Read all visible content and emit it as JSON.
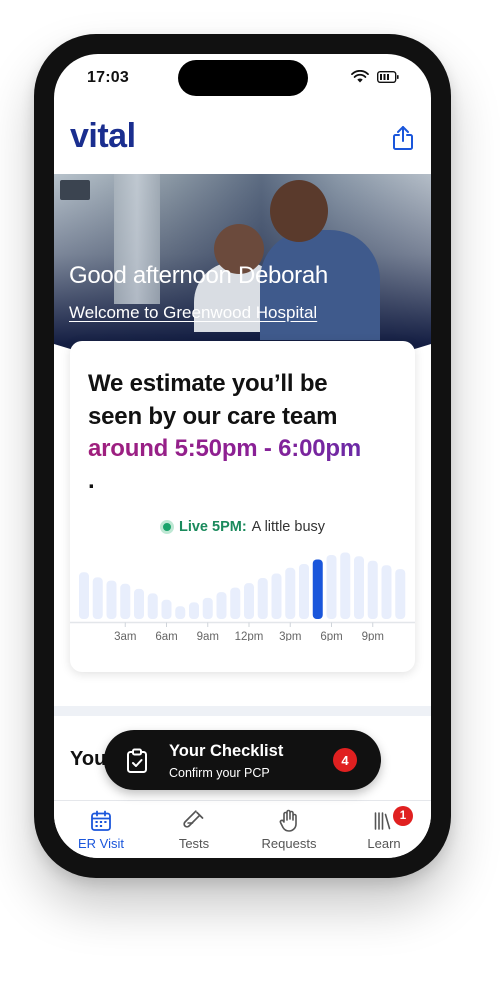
{
  "status_bar": {
    "time": "17:03"
  },
  "header": {
    "logo": "vital",
    "share_icon": "share-icon"
  },
  "hero": {
    "greeting": "Good afternoon Deborah",
    "welcome_link": "Welcome to Greenwood Hospital"
  },
  "estimate": {
    "line1": "We estimate you’ll be",
    "line2": "seen by our care team",
    "range": "around 5:50pm - 6:00pm",
    "trailing": ".",
    "live_label": "Live 5PM:",
    "live_desc": "A little busy",
    "colors": {
      "live": "#1aa36b",
      "current_bar": "#1a56db",
      "bar": "#e8eefc"
    }
  },
  "chart_data": {
    "type": "bar",
    "categories": [
      "12am",
      "1am",
      "2am",
      "3am",
      "4am",
      "5am",
      "6am",
      "7am",
      "8am",
      "9am",
      "10am",
      "11am",
      "12pm",
      "1pm",
      "2pm",
      "3pm",
      "4pm",
      "5pm",
      "6pm",
      "7pm",
      "8pm",
      "9pm",
      "10pm",
      "11pm"
    ],
    "values": [
      0.73,
      0.65,
      0.6,
      0.55,
      0.47,
      0.4,
      0.3,
      0.2,
      0.26,
      0.33,
      0.42,
      0.49,
      0.56,
      0.64,
      0.71,
      0.8,
      0.86,
      0.93,
      1.0,
      1.04,
      0.98,
      0.91,
      0.84,
      0.78
    ],
    "highlight_index": 17,
    "tick_labels": [
      "3am",
      "6am",
      "9am",
      "12pm",
      "3pm",
      "6pm",
      "9pm"
    ],
    "tick_indices": [
      3,
      6,
      9,
      12,
      15,
      18,
      21
    ],
    "title": "",
    "xlabel": "",
    "ylabel": ""
  },
  "section": {
    "title": "You"
  },
  "checklist": {
    "title": "Your Checklist",
    "subtitle": "Confirm your PCP",
    "badge": "4",
    "icon": "clipboard-check-icon"
  },
  "tabs": [
    {
      "label": "ER Visit",
      "icon": "calendar-icon",
      "active": true
    },
    {
      "label": "Tests",
      "icon": "test-tube-icon",
      "active": false
    },
    {
      "label": "Requests",
      "icon": "hand-icon",
      "active": false
    },
    {
      "label": "Learn",
      "icon": "library-icon",
      "active": false,
      "badge": "1"
    }
  ]
}
